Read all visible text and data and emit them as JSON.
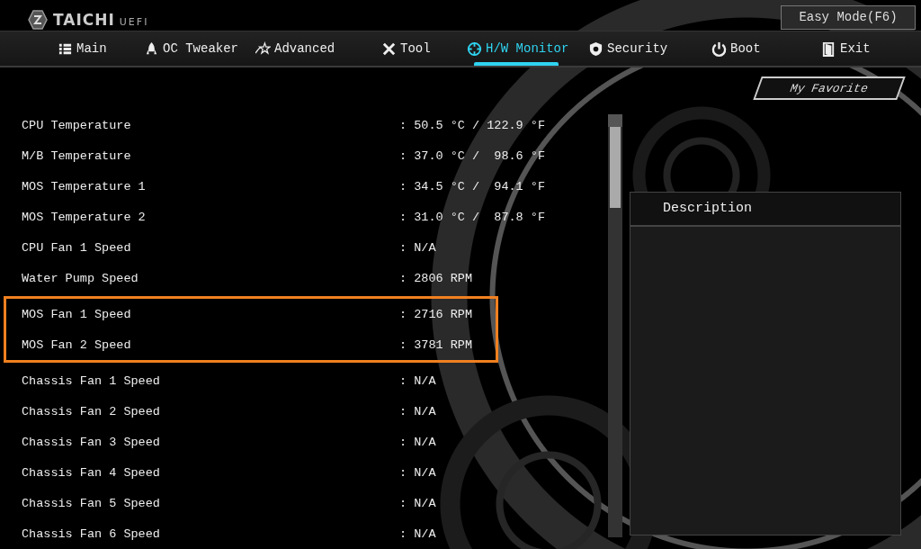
{
  "header": {
    "logo_text": "TAICHI",
    "logo_suffix": "UEFI",
    "mode_button": "Easy Mode(F6)"
  },
  "tabs": [
    {
      "label": "Main",
      "selected": false
    },
    {
      "label": "OC Tweaker",
      "selected": false
    },
    {
      "label": "Advanced",
      "selected": false
    },
    {
      "label": "Tool",
      "selected": false
    },
    {
      "label": "H/W Monitor",
      "selected": true
    },
    {
      "label": "Security",
      "selected": false
    },
    {
      "label": "Boot",
      "selected": false
    },
    {
      "label": "Exit",
      "selected": false
    }
  ],
  "favorite_button": "My Favorite",
  "row_groups": [
    {
      "highlighted": false,
      "rows": [
        {
          "label": "CPU Temperature",
          "value": ": 50.5 °C / 122.9 °F"
        },
        {
          "label": "M/B Temperature",
          "value": ": 37.0 °C /  98.6 °F"
        },
        {
          "label": "MOS Temperature 1",
          "value": ": 34.5 °C /  94.1 °F"
        },
        {
          "label": "MOS Temperature 2",
          "value": ": 31.0 °C /  87.8 °F"
        },
        {
          "label": "CPU Fan 1 Speed",
          "value": ": N/A"
        },
        {
          "label": "Water Pump Speed",
          "value": ": 2806 RPM"
        }
      ]
    },
    {
      "highlighted": true,
      "rows": [
        {
          "label": "MOS Fan 1 Speed",
          "value": ": 2716 RPM"
        },
        {
          "label": "MOS Fan 2 Speed",
          "value": ": 3781 RPM"
        }
      ]
    },
    {
      "highlighted": false,
      "rows": [
        {
          "label": "Chassis Fan 1 Speed",
          "value": ": N/A"
        },
        {
          "label": "Chassis Fan 2 Speed",
          "value": ": N/A"
        },
        {
          "label": "Chassis Fan 3 Speed",
          "value": ": N/A"
        },
        {
          "label": "Chassis Fan 4 Speed",
          "value": ": N/A"
        },
        {
          "label": "Chassis Fan 5 Speed",
          "value": ": N/A"
        },
        {
          "label": "Chassis Fan 6 Speed",
          "value": ": N/A"
        }
      ]
    }
  ],
  "description": {
    "title": "Description"
  }
}
